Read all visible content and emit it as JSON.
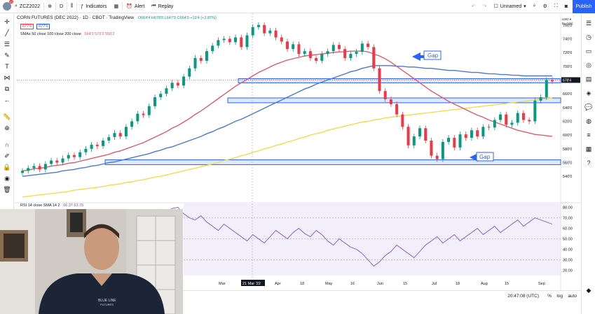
{
  "header": {
    "symbol": "ZCZ2022",
    "interval": "D",
    "indicators": "Indicators",
    "alert": "Alert",
    "replay": "Replay",
    "layout_name": "Unnamed",
    "publish": "Publish",
    "notif_count": "10"
  },
  "legend": {
    "title": "CORN FUTURES (DEC 2022) · 1D · CBOT · TradingView",
    "ohlc": "O664'4 H670'0 L647'0 C664'0 +19'4 (+2.87%)",
    "price_a": "677'6",
    "price_b": "677'6",
    "sma_label": "SMAs 50 close 100 close 200 close",
    "sma_vals": "594'3  573'2  550'2",
    "rsi_label": "RSI 14 close SMA 14 2",
    "rsi_vals": "66.37  63.75"
  },
  "annotations": {
    "gap_top": "Gap",
    "gap_bottom": "Gap"
  },
  "price_axis": {
    "currency": "USD ▾",
    "unit": "bu (US)",
    "labels": [
      "760'0",
      "740'0",
      "720'0",
      "700'0",
      "680'0",
      "660'0",
      "640'0",
      "620'0",
      "600'0",
      "580'0",
      "560'0",
      "540'0"
    ],
    "current": "678'4"
  },
  "rsi_axis": {
    "labels": [
      "80.00",
      "70.00",
      "60.00",
      "50.00",
      "40.00",
      "30.00",
      "20.00"
    ]
  },
  "time_axis": {
    "labels": [
      "Mar",
      "21 Mar '22",
      "Apr",
      "18",
      "May",
      "16",
      "Jun",
      "15",
      "Jul",
      "18",
      "Aug",
      "15",
      "Sep"
    ]
  },
  "bottom": {
    "time": "20:47:08 (UTC)",
    "pct": "%",
    "log": "log",
    "auto": "auto"
  },
  "webcam": {
    "shirt_text_1": "BLUE LINE",
    "shirt_text_2": "FUTURES"
  },
  "colors": {
    "up": "#089981",
    "down": "#f23645",
    "sma50": "#e05c6b",
    "sma100": "#4a78d6",
    "sma200": "#f0dc50",
    "rsi": "#7e57c2",
    "zone": "#2962ff",
    "accent": "#2962ff"
  },
  "chart_data": {
    "type": "candlestick",
    "series": [
      {
        "name": "ZCZ2022",
        "values": [
          548,
          552,
          555,
          550,
          558,
          563,
          560,
          566,
          571,
          568,
          575,
          580,
          586,
          584,
          592,
          597,
          603,
          598,
          612,
          620,
          631,
          629,
          642,
          655,
          660,
          668,
          676,
          672,
          685,
          697,
          712,
          708,
          722,
          730,
          738,
          740,
          735,
          742,
          728,
          745,
          757,
          760,
          748,
          752,
          742,
          736,
          725,
          732,
          718,
          722,
          712,
          708,
          718,
          722,
          731,
          725,
          712,
          718,
          721,
          733,
          728,
          697,
          664,
          652,
          645,
          630,
          612,
          585,
          598,
          610,
          592,
          570,
          565,
          590,
          596,
          582,
          601,
          596,
          607,
          598,
          612,
          611,
          622,
          630,
          615,
          618,
          632,
          622,
          620,
          650,
          655,
          680,
          678
        ]
      },
      {
        "name": "SMA 50",
        "values": [
          548,
          549,
          551,
          552,
          553,
          555,
          556,
          557,
          559,
          560,
          562,
          564,
          566,
          568,
          570,
          572,
          575,
          577,
          580,
          583,
          586,
          589,
          593,
          597,
          601,
          605,
          610,
          614,
          619,
          624,
          630,
          635,
          641,
          647,
          653,
          659,
          665,
          671,
          676,
          681,
          686,
          691,
          695,
          699,
          703,
          706,
          709,
          711,
          713,
          715,
          716,
          717,
          718,
          719,
          720,
          721,
          721,
          722,
          722,
          722,
          721,
          718,
          715,
          711,
          706,
          700,
          694,
          688,
          682,
          676,
          670,
          664,
          659,
          654,
          649,
          645,
          641,
          637,
          633,
          629,
          626,
          622,
          619,
          616,
          613,
          610,
          607,
          605,
          603,
          601,
          600,
          599,
          598
        ]
      },
      {
        "name": "SMA 100",
        "values": [
          540,
          541,
          542,
          543,
          544,
          545,
          546,
          548,
          549,
          550,
          552,
          553,
          555,
          556,
          558,
          560,
          561,
          563,
          565,
          567,
          569,
          571,
          573,
          576,
          578,
          581,
          583,
          586,
          589,
          592,
          595,
          598,
          602,
          605,
          609,
          612,
          616,
          620,
          623,
          627,
          631,
          635,
          639,
          643,
          647,
          651,
          655,
          659,
          663,
          667,
          670,
          674,
          677,
          680,
          683,
          686,
          689,
          692,
          694,
          697,
          699,
          701,
          701,
          701,
          701,
          700,
          700,
          699,
          699,
          698,
          697,
          697,
          696,
          695,
          694,
          694,
          693,
          692,
          691,
          691,
          690,
          689,
          689,
          688,
          688,
          687,
          687,
          686,
          686,
          686,
          686,
          686,
          686
        ]
      },
      {
        "name": "SMA 200",
        "values": [
          510,
          511,
          512,
          513,
          514,
          515,
          516,
          517,
          518,
          520,
          521,
          522,
          523,
          524,
          525,
          527,
          528,
          529,
          531,
          532,
          534,
          535,
          537,
          539,
          540,
          542,
          544,
          546,
          548,
          550,
          552,
          554,
          556,
          558,
          560,
          563,
          565,
          567,
          570,
          572,
          575,
          577,
          580,
          582,
          585,
          587,
          590,
          592,
          595,
          597,
          600,
          602,
          604,
          607,
          609,
          611,
          613,
          615,
          617,
          619,
          620,
          622,
          623,
          625,
          626,
          627,
          628,
          629,
          630,
          631,
          632,
          633,
          634,
          635,
          636,
          637,
          638,
          639,
          640,
          641,
          642,
          643,
          644,
          645,
          646,
          647,
          648,
          649,
          650,
          651,
          652,
          653,
          654
        ]
      },
      {
        "name": "RSI",
        "values": [
          55,
          58,
          52,
          60,
          57,
          62,
          59,
          64,
          61,
          66,
          63,
          60,
          58,
          65,
          68,
          63,
          70,
          66,
          72,
          68,
          74,
          70,
          76,
          72,
          78,
          75,
          79,
          80,
          74,
          70,
          68,
          72,
          66,
          62,
          58,
          64,
          60,
          56,
          52,
          48,
          54,
          50,
          46,
          52,
          58,
          54,
          50,
          56,
          60,
          55,
          52,
          58,
          54,
          48,
          44,
          50,
          46,
          42,
          40,
          36,
          30,
          24,
          28,
          34,
          38,
          44,
          40,
          36,
          32,
          38,
          44,
          48,
          52,
          46,
          50,
          54,
          48,
          52,
          56,
          60,
          54,
          58,
          62,
          56,
          60,
          64,
          68,
          62,
          66,
          70,
          68,
          66,
          64
        ]
      }
    ],
    "ylim": [
      530,
      775
    ],
    "rsi_ylim": [
      15,
      85
    ]
  }
}
